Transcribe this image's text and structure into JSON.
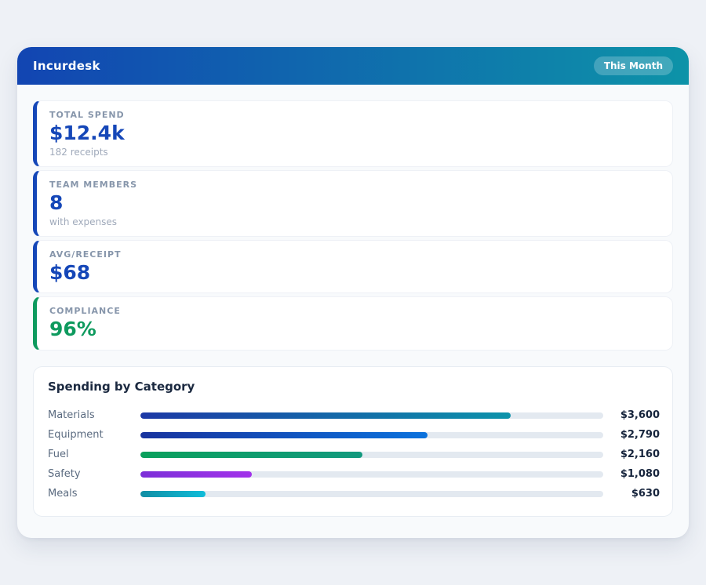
{
  "app": {
    "title": "Incurdesk",
    "period_badge": "This Month",
    "header_gradient": [
      "#1245b2",
      "#0d93a8"
    ]
  },
  "stats": [
    {
      "id": "total-spend",
      "label": "TOTAL SPEND",
      "value": "$12.4k",
      "sub": "182 receipts",
      "accent": "#1547b8",
      "value_color": "#1547b8"
    },
    {
      "id": "team-members",
      "label": "TEAM MEMBERS",
      "value": "8",
      "sub": "with expenses",
      "accent": "#1547b8",
      "value_color": "#1547b8"
    },
    {
      "id": "avg-receipt",
      "label": "AVG/RECEIPT",
      "value": "$68",
      "sub": "",
      "accent": "#1547b8",
      "value_color": "#1547b8"
    },
    {
      "id": "compliance",
      "label": "COMPLIANCE",
      "value": "96%",
      "sub": "",
      "accent": "#0e9a5e",
      "value_color": "#0e9a5e"
    }
  ],
  "chart_data": {
    "type": "bar",
    "orientation": "horizontal",
    "title": "Spending by Category",
    "categories": [
      "Materials",
      "Equipment",
      "Fuel",
      "Safety",
      "Meals"
    ],
    "values": [
      3600,
      2790,
      2160,
      1080,
      630
    ],
    "value_labels": [
      "$3,600",
      "$2,790",
      "$2,160",
      "$1,080",
      "$630"
    ],
    "scale_max": 4500,
    "track_color": "#e3e9f0",
    "bar_gradients": [
      [
        "#1c38a6",
        "#0c93aa"
      ],
      [
        "#18339e",
        "#0b72dd"
      ],
      [
        "#0aa05c",
        "#12997e"
      ],
      [
        "#7c2fd8",
        "#a232ea"
      ],
      [
        "#118ea4",
        "#0fbcd9"
      ]
    ]
  }
}
